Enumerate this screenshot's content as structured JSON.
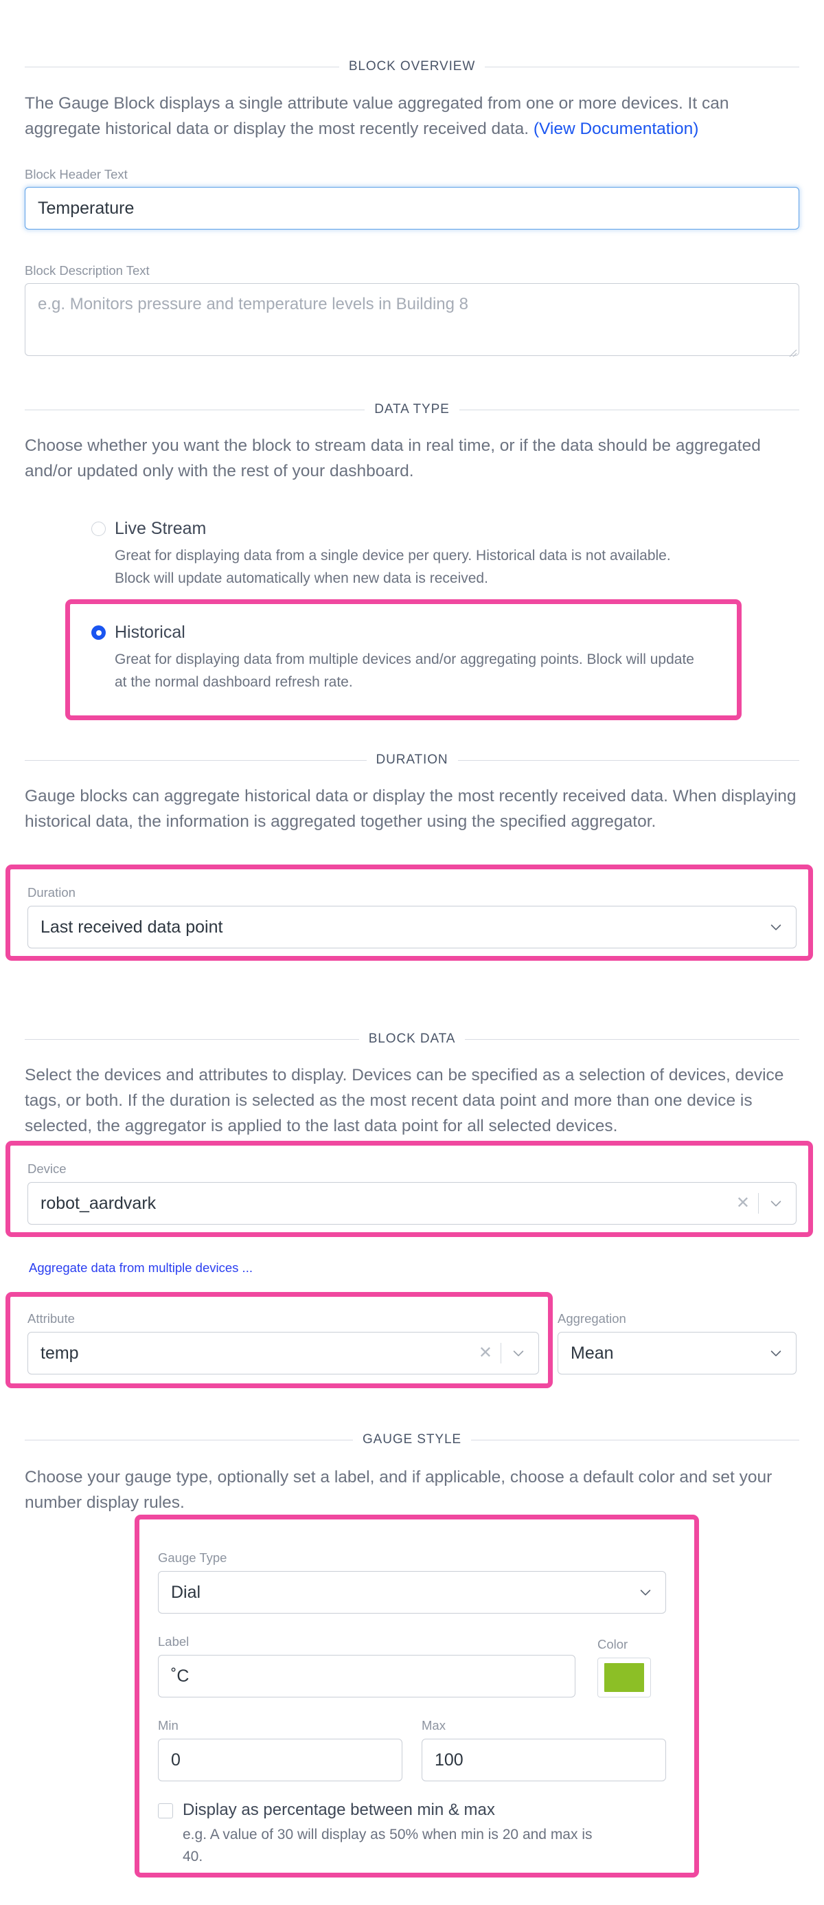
{
  "sections": {
    "overview": {
      "caption": "BLOCK OVERVIEW",
      "description_part1": "The Gauge Block displays a single attribute value aggregated from one or more devices. It can aggregate historical data or display the most recently received data. ",
      "doc_link": "(View Documentation)",
      "header_label": "Block Header Text",
      "header_value": "Temperature",
      "header_placeholder": "Block Header Text",
      "desc_label": "Block Description Text",
      "desc_value": "",
      "desc_placeholder": "e.g. Monitors pressure and temperature levels in Building 8"
    },
    "data_type": {
      "caption": "DATA TYPE",
      "description": "Choose whether you want the block to stream data in real time, or if the data should be aggregated and/or updated only with the rest of your dashboard.",
      "options": [
        {
          "label": "Live Stream",
          "description": "Great for displaying data from a single device per query. Historical data is not available. Block will update automatically when new data is received.",
          "selected": false
        },
        {
          "label": "Historical",
          "description": "Great for displaying data from multiple devices and/or aggregating points. Block will update at the normal dashboard refresh rate.",
          "selected": true
        }
      ]
    },
    "duration": {
      "caption": "DURATION",
      "description": "Gauge blocks can aggregate historical data or display the most recently received data. When displaying historical data, the information is aggregated together using the specified aggregator.",
      "field_label": "Duration",
      "field_value": "Last received data point"
    },
    "block_data": {
      "caption": "BLOCK DATA",
      "description": "Select the devices and attributes to display. Devices can be specified as a selection of devices, device tags, or both. If the duration is selected as the most recent data point and more than one device is selected, the aggregator is applied to the last data point for all selected devices.",
      "device_label": "Device",
      "device_value": "robot_aardvark",
      "aggregate_link": "Aggregate data from multiple devices ...",
      "attribute_label": "Attribute",
      "attribute_value": "temp",
      "aggregation_label": "Aggregation",
      "aggregation_value": "Mean"
    },
    "gauge_style": {
      "caption": "GAUGE STYLE",
      "description": "Choose your gauge type, optionally set a label, and if applicable, choose a default color and set your number display rules.",
      "gauge_type_label": "Gauge Type",
      "gauge_type_value": "Dial",
      "label_label": "Label",
      "label_value": "˚C",
      "color_label": "Color",
      "color_value": "#8cbf26",
      "min_label": "Min",
      "min_value": "0",
      "max_label": "Max",
      "max_value": "100",
      "percentage_checkbox_label": "Display as percentage between min & max",
      "percentage_checkbox_desc": "e.g. A value of 30 will display as 50% when min is 20 and max is 40.",
      "percentage_checked": false
    }
  },
  "icons": {
    "chevron_down": "chevron-down-icon",
    "clear": "✕"
  },
  "annotation_color": "#f0489f"
}
